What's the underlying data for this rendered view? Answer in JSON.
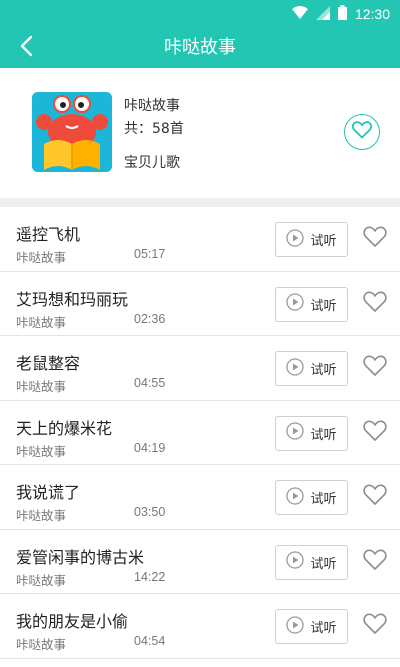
{
  "status": {
    "time": "12:30"
  },
  "appbar": {
    "title": "咔哒故事",
    "back_icon": "back-arrow-icon"
  },
  "album": {
    "name": "咔哒故事",
    "count_prefix": "共：",
    "count_value": "58首",
    "category": "宝贝儿歌",
    "cover_icon": "crab-reading-book-icon",
    "fav_icon": "heart-outline-icon"
  },
  "colors": {
    "accent": "#23c6b3",
    "divider": "#efefef"
  },
  "songs": [
    {
      "title": "遥控飞机",
      "artist": "咔哒故事",
      "duration": "05:17",
      "listen_label": "试听"
    },
    {
      "title": "艾玛想和玛丽玩",
      "artist": "咔哒故事",
      "duration": "02:36",
      "listen_label": "试听"
    },
    {
      "title": "老鼠整容",
      "artist": "咔哒故事",
      "duration": "04:55",
      "listen_label": "试听"
    },
    {
      "title": "天上的爆米花",
      "artist": "咔哒故事",
      "duration": "04:19",
      "listen_label": "试听"
    },
    {
      "title": "我说谎了",
      "artist": "咔哒故事",
      "duration": "03:50",
      "listen_label": "试听"
    },
    {
      "title": "爱管闲事的博古米",
      "artist": "咔哒故事",
      "duration": "14:22",
      "listen_label": "试听"
    },
    {
      "title": "我的朋友是小偷",
      "artist": "咔哒故事",
      "duration": "04:54",
      "listen_label": "试听"
    }
  ]
}
